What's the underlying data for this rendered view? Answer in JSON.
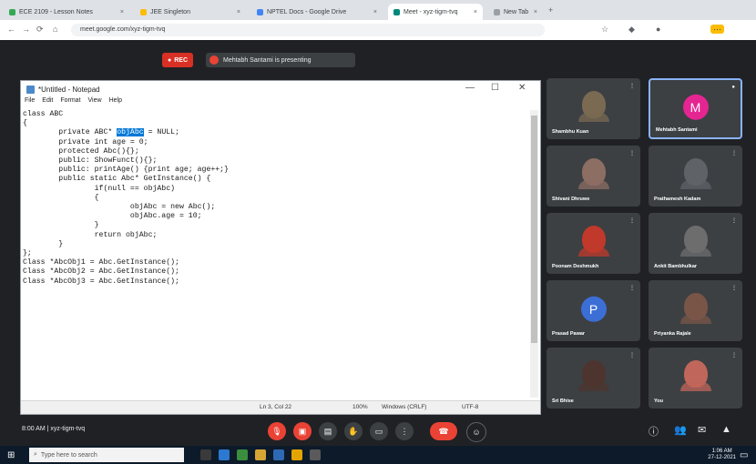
{
  "browser": {
    "tabs": [
      {
        "label": "ECE 2109 - Lesson Notes",
        "color": "#34a853"
      },
      {
        "label": "JEE Singleton",
        "color": "#fbbc04"
      },
      {
        "label": "NPTEL Docs - Google Drive",
        "color": "#4285f4"
      },
      {
        "label": "Meet - xyz-tigm-tvq",
        "color": "#00897b"
      },
      {
        "label": "New Tab",
        "color": "#9aa0a6"
      }
    ],
    "active_tab_index": 3,
    "address": "meet.google.com/xyz-tigm-tvq"
  },
  "meeting": {
    "rec_label": "REC",
    "presenting_label": "Mehtabh Santami is presenting",
    "info": "8:00 AM | xyz-tigm-tvq",
    "end_icon": "end-call-icon"
  },
  "notepad": {
    "title": "*Untitled - Notepad",
    "menu": [
      "File",
      "Edit",
      "Format",
      "View",
      "Help"
    ],
    "code": [
      "class ABC",
      "{",
      "        private ABC* objAbc = NULL;",
      "        private int age = 0;",
      "",
      "        protected Abc(){};",
      "        public: ShowFunct(){};",
      "        public: printAge() {print age; age++;}",
      "",
      "        public static Abc* GetInstance() {",
      "                if(null == objAbc)",
      "                {",
      "                        objAbc = new Abc();",
      "                        objAbc.age = 10;",
      "                }",
      "",
      "                return objAbc;",
      "        }",
      "};",
      "",
      "Class *AbcObj1 = Abc.GetInstance();",
      "Class *AbcObj2 = Abc.GetInstance();",
      "Class *AbcObj3 = Abc.GetInstance();"
    ],
    "selected_word": "objAbc",
    "status": {
      "position": "Ln 3, Col 22",
      "zoom": "100%",
      "line_ending": "Windows (CRLF)",
      "encoding": "UTF-8"
    }
  },
  "participants": [
    {
      "name": "Shambhu Kuan",
      "kind": "photo",
      "color": "#7a6a52"
    },
    {
      "name": "Mehtabh Santami",
      "kind": "letter",
      "letter": "M",
      "color": "#e52592",
      "active": true
    },
    {
      "name": "Shivani Dhruwe",
      "kind": "photo",
      "color": "#8d6e63"
    },
    {
      "name": "Prathamesh Kadam",
      "kind": "photo",
      "color": "#5f6368"
    },
    {
      "name": "Poonam Deshmukh",
      "kind": "photo",
      "color": "#c0392b"
    },
    {
      "name": "Ankit Bambhulkar",
      "kind": "photo",
      "color": "#6d6d6d"
    },
    {
      "name": "Prasad Pawar",
      "kind": "letter",
      "letter": "P",
      "color": "#3b6fd6"
    },
    {
      "name": "Priyanka Rajale",
      "kind": "photo",
      "color": "#795548"
    },
    {
      "name": "Sri Bhise",
      "kind": "photo",
      "color": "#4e342e"
    },
    {
      "name": "You",
      "kind": "photo",
      "color": "#c1665a"
    }
  ],
  "controls": {
    "mic_icon": "mic-off-icon",
    "cam_icon": "camera-off-icon",
    "cc_icon": "captions-icon",
    "hand_icon": "raise-hand-icon",
    "present_icon": "present-icon",
    "more_icon": "more-options-icon"
  },
  "taskbar": {
    "search_placeholder": "Type here to search",
    "time": "1:06 AM",
    "date": "27-12-2021"
  }
}
